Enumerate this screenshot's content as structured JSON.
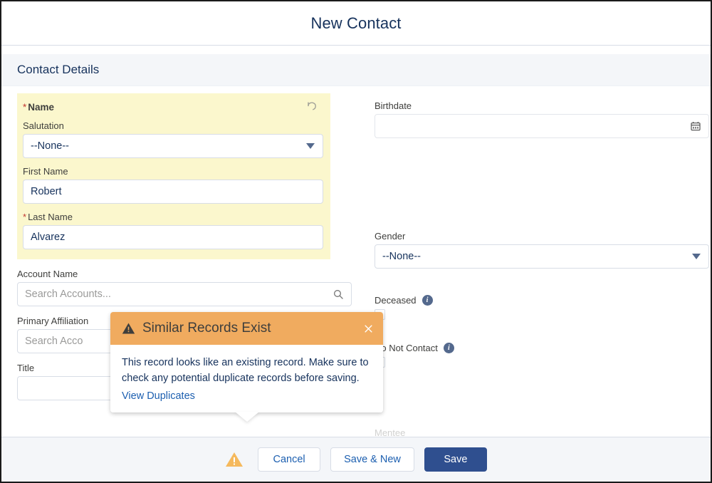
{
  "modal": {
    "title": "New Contact",
    "section_title": "Contact Details"
  },
  "name_block": {
    "label": "Name",
    "required_marker": "*",
    "undo_icon": "undo-icon"
  },
  "fields": {
    "salutation": {
      "label": "Salutation",
      "value": "--None--"
    },
    "first_name": {
      "label": "First Name",
      "value": "Robert"
    },
    "last_name": {
      "label": "Last Name",
      "value": "Alvarez",
      "required_marker": "*"
    },
    "account_name": {
      "label": "Account Name",
      "placeholder": "Search Accounts...",
      "icon": "search-icon"
    },
    "primary_affiliation": {
      "label": "Primary Affiliation",
      "placeholder": "Search Acco",
      "icon": "search-icon"
    },
    "title": {
      "label": "Title",
      "value": ""
    },
    "birthdate": {
      "label": "Birthdate",
      "value": "",
      "icon": "calendar-icon"
    },
    "gender": {
      "label": "Gender",
      "value": "--None--"
    },
    "deceased": {
      "label": "Deceased",
      "info_icon": "info-icon"
    },
    "do_not_contact": {
      "label": "Do Not Contact",
      "info_icon": "info-icon"
    },
    "mentee": {
      "label": "Mentee",
      "placeholder": "",
      "icon": "search-icon"
    }
  },
  "popover": {
    "title": "Similar Records Exist",
    "warning_icon": "warning-triangle-icon",
    "close_icon": "close-icon",
    "body": "This record looks like an existing record. Make sure to check any potential duplicate records before saving.",
    "link": "View Duplicates",
    "header_color": "#f0ab5f"
  },
  "footer": {
    "warning_icon": "warning-triangle-icon",
    "cancel": "Cancel",
    "save_new": "Save & New",
    "save": "Save",
    "primary_color": "#2f4f8f"
  }
}
